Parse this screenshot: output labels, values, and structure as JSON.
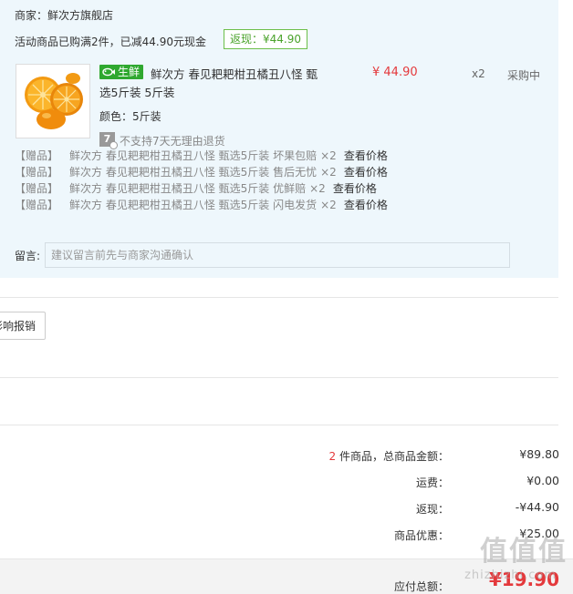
{
  "order": {
    "merchant": "商家：鲜次方旗舰店",
    "promo": "活动商品已购满2件，已减44.90元现金",
    "rebate_tag": "返现：¥44.90",
    "item": {
      "badge": "生鲜",
      "title_line1": "鲜次方 春见耙耙柑丑橘丑八怪 甄",
      "title_line2": "选5斤装 5斤装",
      "spec": "颜色：5斤装",
      "price": "¥ 44.90",
      "qty": "x2",
      "status": "采购中",
      "no_return_icon": "7",
      "no_return_text": "不支持7天无理由退货"
    },
    "gifts": [
      {
        "tag": "【赠品】",
        "name": "鲜次方 春见耙耙柑丑橘丑八怪 甄选5斤装 坏果包赔",
        "qty": "×2",
        "price_link": "查看价格"
      },
      {
        "tag": "【赠品】",
        "name": "鲜次方 春见耙耙柑丑橘丑八怪 甄选5斤装 售后无忧",
        "qty": "×2",
        "price_link": "查看价格"
      },
      {
        "tag": "【赠品】",
        "name": "鲜次方 春见耙耙柑丑橘丑八怪 甄选5斤装 优鲜赔",
        "qty": "×2",
        "price_link": "查看价格"
      },
      {
        "tag": "【赠品】",
        "name": "鲜次方 春见耙耙柑丑橘丑八怪 甄选5斤装 闪电发货",
        "qty": "×2",
        "price_link": "查看价格"
      }
    ],
    "note": {
      "label": "留言:",
      "placeholder": "建议留言前先与商家沟通确认"
    }
  },
  "report_button": "影响报销",
  "summary": {
    "count": "2",
    "count_suffix": " 件商品，总商品金额：",
    "goods_total": "¥89.80",
    "shipping_label": "运费：",
    "shipping_value": "¥0.00",
    "rebate_label": "返现：",
    "rebate_value": "-¥44.90",
    "discount_label": "商品优惠：",
    "discount_value": "¥25.00",
    "total_label": "应付总额：",
    "total_value": "¥19.90"
  },
  "watermark": {
    "main": "值值值",
    "sub": "zhizhizhi.com"
  },
  "colors": {
    "panel_bg": "#eef7fc",
    "price_red": "#e4393c",
    "fresh_green": "#2fa82f",
    "rebate_green": "#4aa32b"
  }
}
